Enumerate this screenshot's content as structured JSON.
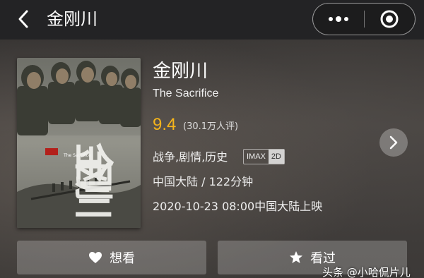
{
  "navbar": {
    "title": "金刚川",
    "back_icon": "chevron-left-icon",
    "more_icon": "more-dots-icon",
    "close_icon": "target-circle-icon"
  },
  "movie": {
    "title": "金刚川",
    "english_title": "The Sacrifice",
    "score": "9.4",
    "rating_count": "(30.1万人评)",
    "genres": "战争,剧情,历史",
    "format_badges": [
      "IMAX",
      "2D"
    ],
    "region_duration": "中国大陆 / 122分钟",
    "release": "2020-10-23 08:00中国大陆上映",
    "score_color": "#f5b41b"
  },
  "poster": {
    "title_text": "金刚川",
    "subtitle_text": "The Sacrifice"
  },
  "actions": {
    "want_label": "想看",
    "seen_label": "看过"
  },
  "watermark": "头条 @小哈侃片儿"
}
